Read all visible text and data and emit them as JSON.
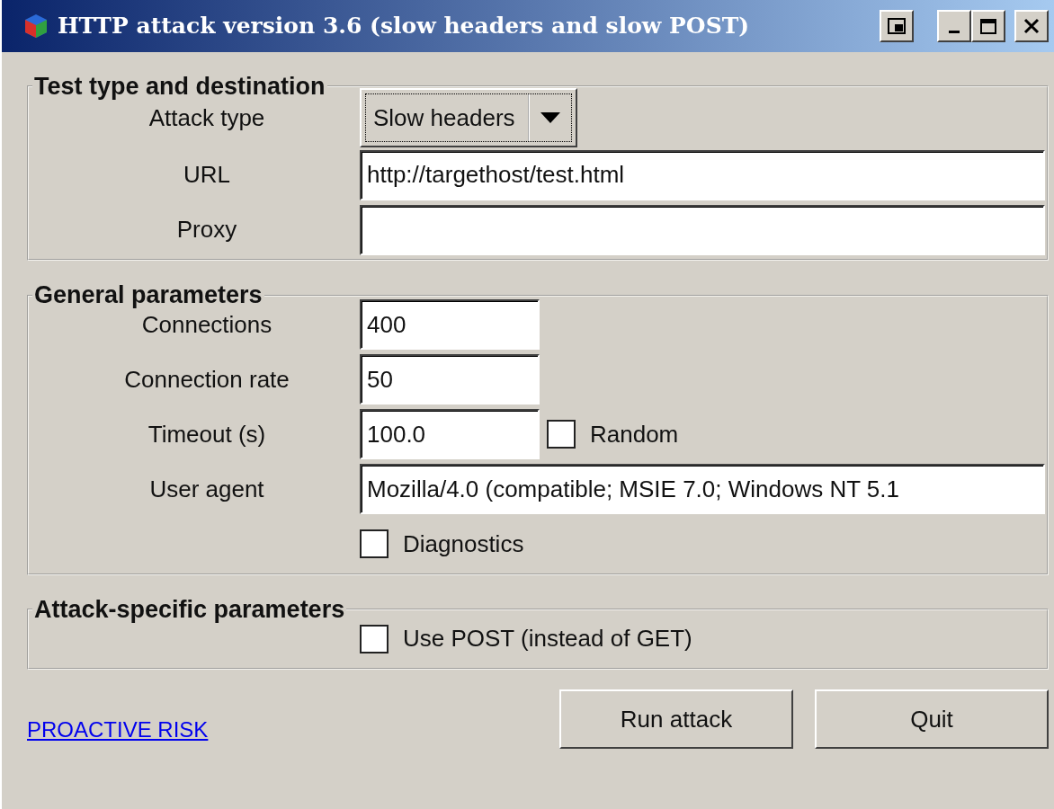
{
  "window": {
    "title": "HTTP attack version 3.6 (slow headers and slow POST)"
  },
  "groups": [
    {
      "legend": "Test type and destination",
      "rows": [
        {
          "kind": "dropdown",
          "label": "Attack type",
          "value": "Slow headers"
        },
        {
          "kind": "long",
          "label": "URL",
          "value": "http://targethost/test.html"
        },
        {
          "kind": "long",
          "label": "Proxy"
        }
      ]
    },
    {
      "legend": "General parameters",
      "rows": [
        {
          "kind": "short",
          "label": "Connections",
          "value": "400"
        },
        {
          "kind": "short",
          "label": "Connection rate",
          "value": "50"
        },
        {
          "kind": "short",
          "label": "Timeout (s)",
          "value": "100.0",
          "option": {
            "label": "Random",
            "checked": false
          }
        },
        {
          "kind": "long",
          "label": "User agent",
          "value": "Mozilla/4.0 (compatible; MSIE 7.0; Windows NT 5.1"
        },
        {
          "kind": "checkbox",
          "label": "Diagnostics",
          "checked": false
        }
      ]
    },
    {
      "legend": "Attack-specific parameters",
      "rows": [
        {
          "kind": "checkbox",
          "label": "Use POST (instead of GET)",
          "checked": false
        }
      ]
    }
  ],
  "footer": {
    "link": "PROACTIVE RISK",
    "buttons": [
      "Run attack",
      "Quit"
    ]
  }
}
